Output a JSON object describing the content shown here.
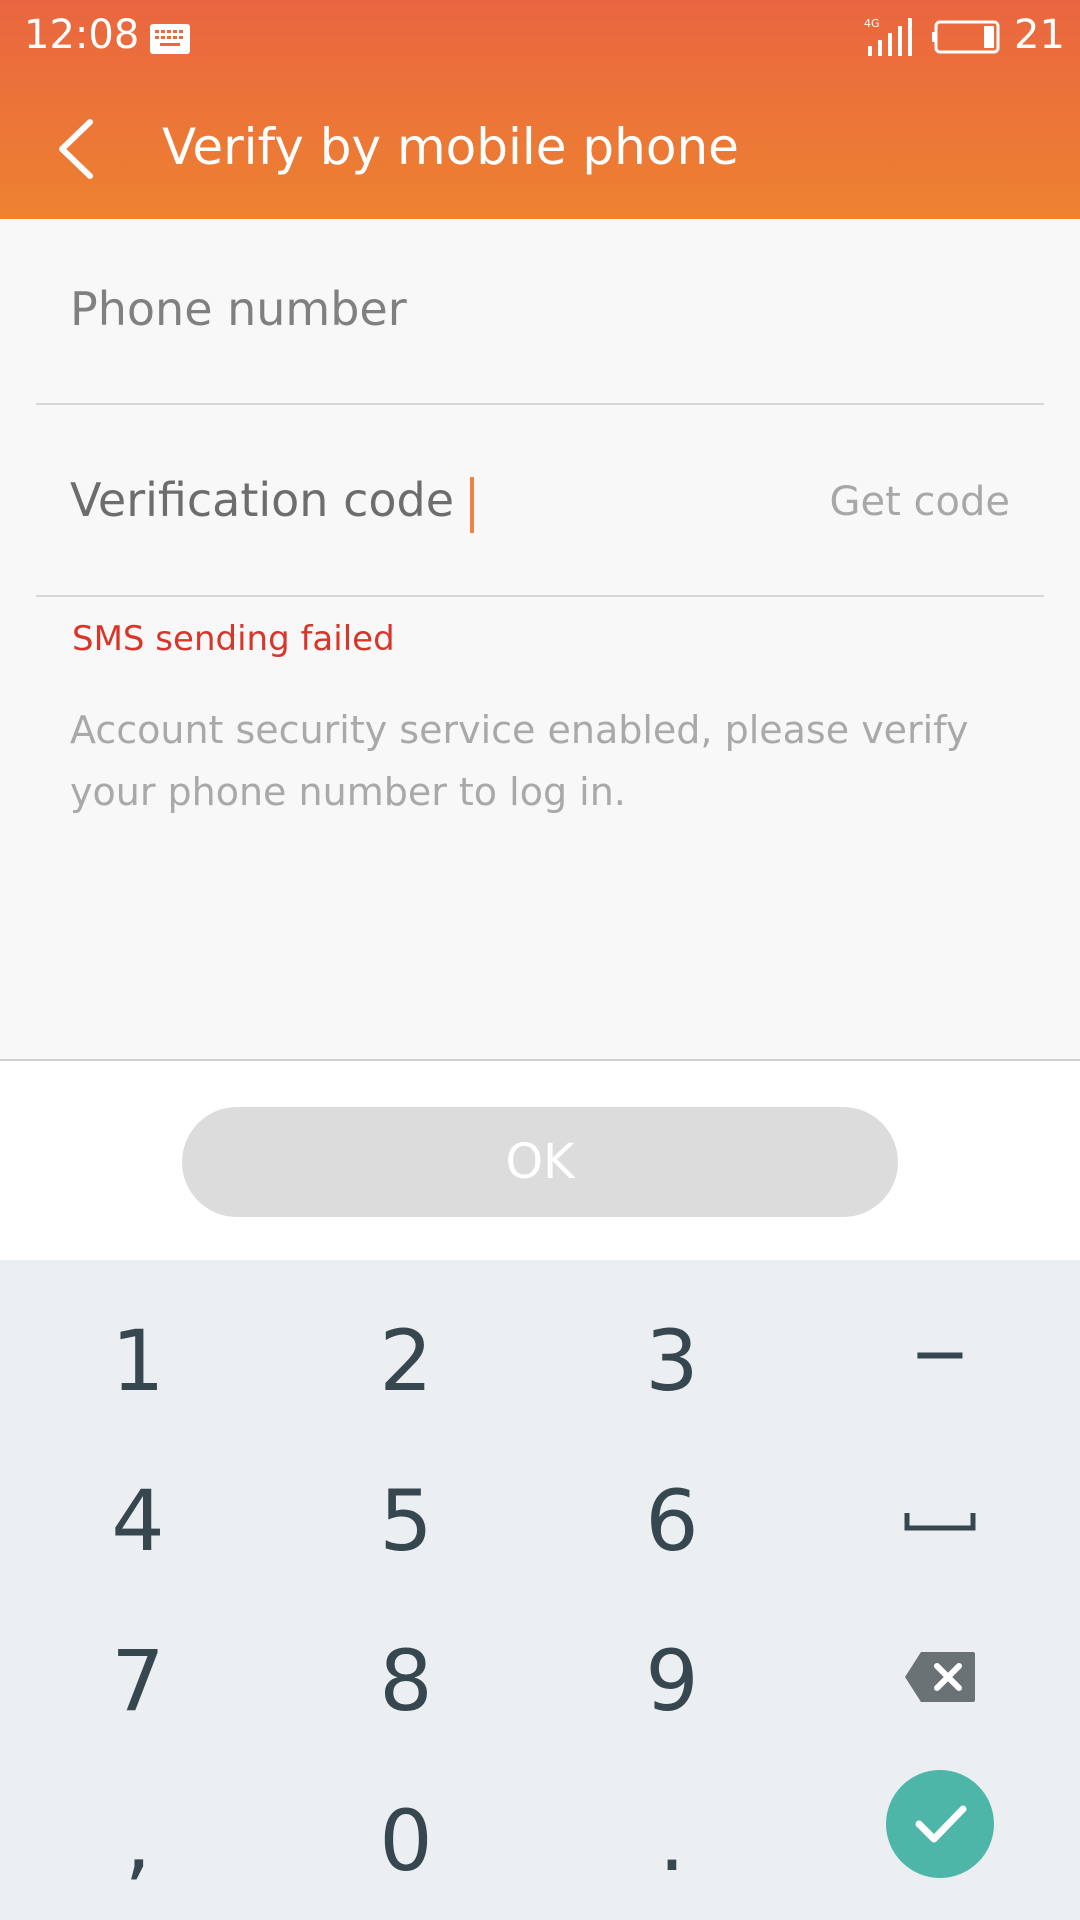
{
  "status_bar": {
    "time": "12:08",
    "battery": "21"
  },
  "header": {
    "title": "Verify by mobile phone"
  },
  "form": {
    "phone_placeholder": "Phone number",
    "code_label": "Verification code",
    "get_code": "Get code",
    "error": "SMS sending failed",
    "info": "Account security service enabled, please verify your phone number to log in."
  },
  "ok_button": "OK",
  "keypad": {
    "keys": [
      "1",
      "2",
      "3",
      "−",
      "4",
      "5",
      "6",
      "7",
      "8",
      "9",
      ",",
      "0",
      "."
    ]
  },
  "colors": {
    "header_top": "#ea6640",
    "header_bottom": "#ed8230",
    "error": "#d8362a",
    "confirm": "#4db6a9",
    "caret": "#ef8145"
  }
}
